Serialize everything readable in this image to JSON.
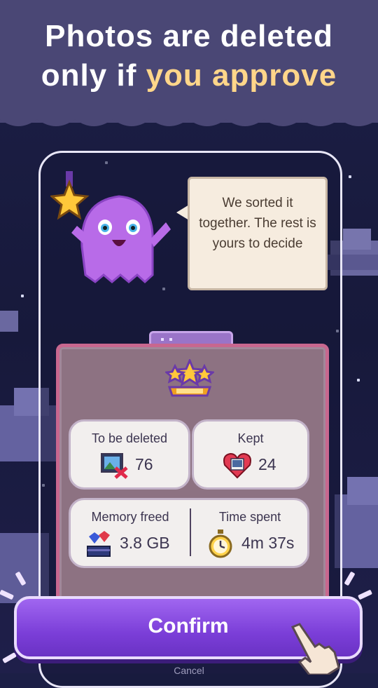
{
  "headline": {
    "line1": "Photos are deleted",
    "line2_prefix": "only if ",
    "line2_highlight": "you approve"
  },
  "speech_bubble": {
    "text": "We sorted it together. The rest is yours to decide"
  },
  "stats": {
    "to_be_deleted": {
      "label": "To be deleted",
      "value": "76"
    },
    "kept": {
      "label": "Kept",
      "value": "24"
    },
    "memory_freed": {
      "label": "Memory freed",
      "value": "3.8 GB"
    },
    "time_spent": {
      "label": "Time spent",
      "value": "4m 37s"
    }
  },
  "actions": {
    "confirm_label": "Confirm",
    "cancel_label": "Cancel"
  },
  "colors": {
    "banner": "#4a4775",
    "highlight": "#ffd68a",
    "button": "#8a4ee6",
    "panel": "#8d7282"
  },
  "icons": [
    "star-medal-icon",
    "ghost-mascot-icon",
    "trophy-stars-icon",
    "photo-delete-icon",
    "heart-photo-icon",
    "gems-stack-icon",
    "stopwatch-icon",
    "pointing-hand-icon"
  ]
}
